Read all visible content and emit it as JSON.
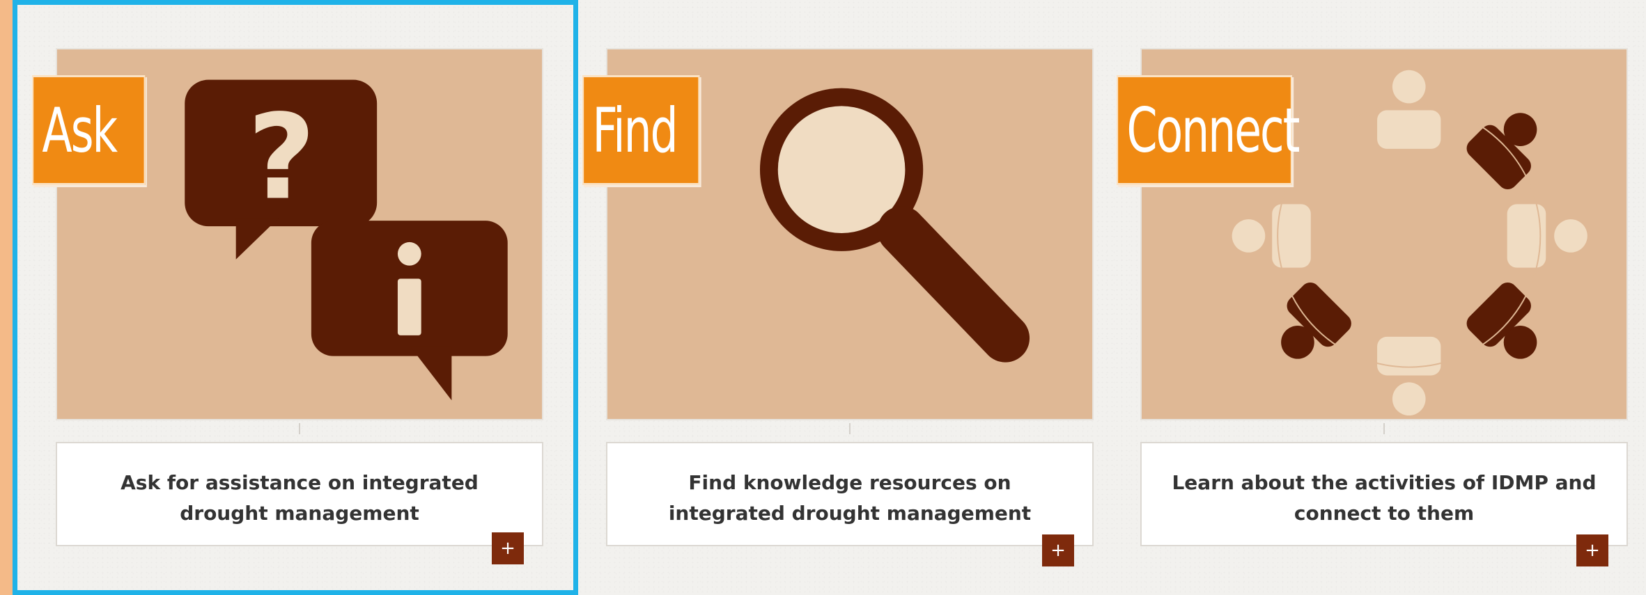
{
  "cards": [
    {
      "title": "Ask",
      "description": "Ask for assistance on integrated drought management",
      "more_label": "+",
      "icon": "speech-bubbles-icon",
      "selected": true
    },
    {
      "title": "Find",
      "description": "Find knowledge resources on integrated drought management",
      "more_label": "+",
      "icon": "magnifying-glass-icon",
      "selected": false
    },
    {
      "title": "Connect",
      "description": "Learn about the activities of IDMP and connect to them",
      "more_label": "+",
      "icon": "people-circle-icon",
      "selected": false
    }
  ],
  "colors": {
    "outer_background": "#f4ba88",
    "tile_background": "#dfb895",
    "badge": "#f08a13",
    "icon_dark": "#5a1c05",
    "icon_light": "#f0dcc2",
    "plus_button": "#7e2a0c",
    "selection_outline": "#1fb2e8"
  }
}
